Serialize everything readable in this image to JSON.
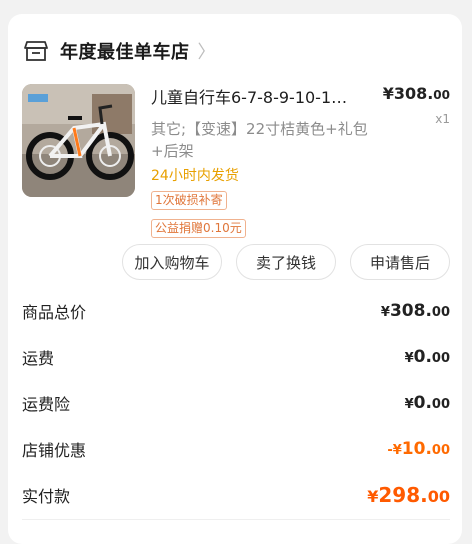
{
  "store": {
    "name": "年度最佳单车店",
    "arrow": "〉"
  },
  "product": {
    "image_icon": "kids-bicycle-photo",
    "title": "儿童自行车6-7-8-9-10-1…",
    "price_main": "¥308.",
    "price_dec": "00",
    "quantity": "x1",
    "spec": "其它;【变速】22寸桔黄色+礼包+后架",
    "shipping": "24小时内发货",
    "tags": [
      "1次破损补寄",
      "公益捐赠0.10元"
    ]
  },
  "actions": {
    "add_to_cart": "加入购物车",
    "resell": "卖了换钱",
    "after_sale": "申请售后"
  },
  "summary": {
    "goods_total": {
      "label": "商品总价",
      "cur": "¥",
      "int": "308.",
      "dec": "00"
    },
    "shipping": {
      "label": "运费",
      "cur": "¥",
      "int": "0.",
      "dec": "00"
    },
    "shipping_insurance": {
      "label": "运费险",
      "cur": "¥",
      "int": "0.",
      "dec": "00"
    },
    "store_discount": {
      "label": "店铺优惠",
      "cur": "-¥",
      "int": "10.",
      "dec": "00"
    },
    "paid": {
      "label": "实付款",
      "cur": "¥",
      "int": "298.",
      "dec": "00"
    }
  },
  "colors": {
    "accent": "#ff5a00",
    "ship": "#e8a000"
  }
}
